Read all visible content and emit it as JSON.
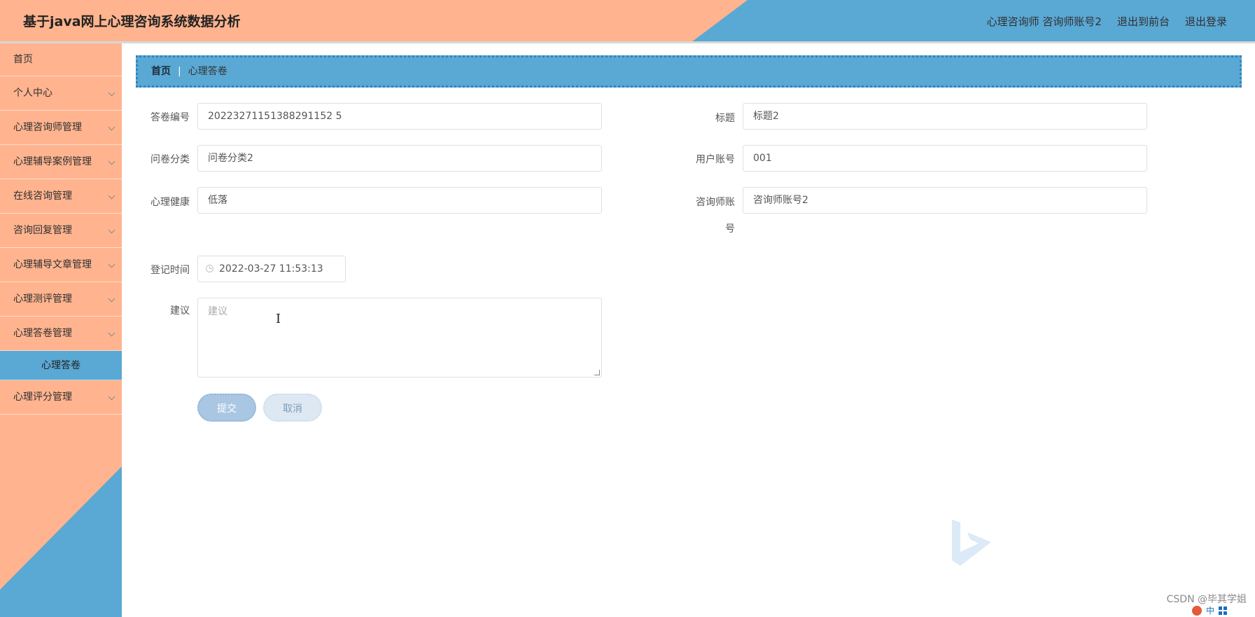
{
  "header": {
    "title": "基于java网上心理咨询系统数据分析",
    "user_info": "心理咨询师 咨询师账号2",
    "back_to_front": "退出到前台",
    "logout": "退出登录"
  },
  "sidebar": {
    "items": [
      {
        "label": "首页"
      },
      {
        "label": "个人中心"
      },
      {
        "label": "心理咨询师管理"
      },
      {
        "label": "心理辅导案例管理"
      },
      {
        "label": "在线咨询管理"
      },
      {
        "label": "咨询回复管理"
      },
      {
        "label": "心理辅导文章管理"
      },
      {
        "label": "心理测评管理"
      },
      {
        "label": "心理答卷管理"
      },
      {
        "label": "心理答卷"
      },
      {
        "label": "心理评分管理"
      }
    ]
  },
  "breadcrumb": {
    "home": "首页",
    "separator": "|",
    "current": "心理答卷"
  },
  "form": {
    "answer_no_label": "答卷编号",
    "answer_no_value": "20223271151388291152 5",
    "title_label": "标题",
    "title_value": "标题2",
    "category_label": "问卷分类",
    "category_value": "问卷分类2",
    "user_account_label": "用户账号",
    "user_account_value": "001",
    "health_label": "心理健康",
    "health_value": "低落",
    "counselor_label_1": "咨询师账",
    "counselor_label_2": "号",
    "counselor_value": "咨询师账号2",
    "reg_time_label": "登记时间",
    "reg_time_value": "2022-03-27 11:53:13",
    "advice_label": "建议",
    "advice_placeholder": "建议",
    "submit_label": "提交",
    "cancel_label": "取消"
  },
  "footer": {
    "watermark": "CSDN @毕其学姐",
    "tray_text": "中"
  },
  "colors": {
    "salmon": "#ffb48f",
    "blue": "#5aa8d4"
  }
}
